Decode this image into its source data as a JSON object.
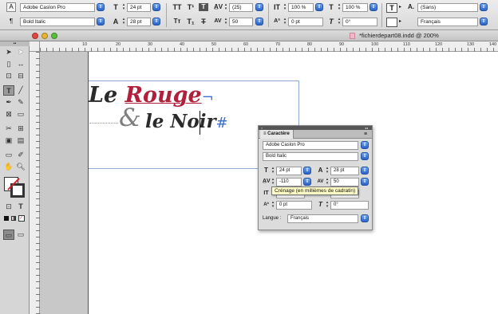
{
  "control_panel": {
    "font_family": "Adobe Caslon Pro",
    "font_style": "Bold Italic",
    "font_size": "24 pt",
    "leading": "28 pt",
    "kerning": "(25)",
    "tracking": "50",
    "vertical_scale": "100 %",
    "horizontal_scale": "100 %",
    "baseline_shift": "0 pt",
    "skew": "0°",
    "caps_tt": "TT",
    "superscript_t": "T¹",
    "subscript_t": "T₁",
    "language_style": "(Sans)",
    "language": "Français"
  },
  "document": {
    "title": "*fichierdepart08.indd @ 200%",
    "line1_a": "Le ",
    "line1_b": "Rouge",
    "hidden_char_1": "¬",
    "ampersand": "&",
    "line2_a": "le ",
    "line2_b": "Noir",
    "hidden_char_2": "#"
  },
  "ruler": {
    "ticks": [
      "10",
      "20",
      "30",
      "40",
      "50",
      "60",
      "70",
      "80",
      "90",
      "100",
      "110",
      "120",
      "130",
      "140"
    ]
  },
  "character_panel": {
    "title": "≡ Caractère",
    "font_family": "Adobe Caslon Pro",
    "font_style": "Bold Italic",
    "font_size": "24 pt",
    "leading": "28 pt",
    "kerning": "-110",
    "tracking": "50",
    "baseline_shift": "0 pt",
    "skew": "0°",
    "tooltip": "Crénage (en millièmes de cadratin)",
    "language_label": "Langue :",
    "language": "Français"
  },
  "colors": {
    "rouge": "#b0203a",
    "noir": "#2a2a2a",
    "selection_blue": "#3a6fd0",
    "frame_blue": "#8fa9cf"
  }
}
